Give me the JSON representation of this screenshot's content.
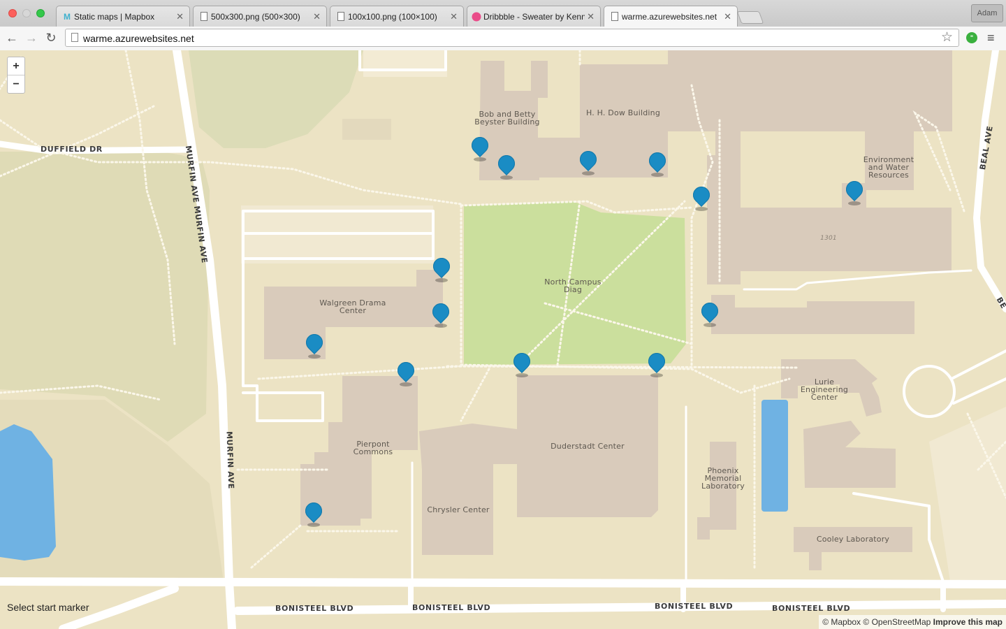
{
  "tabs": [
    {
      "title": "Static maps | Mapbox",
      "icon": "mapbox-icon"
    },
    {
      "title": "500x300.png (500×300)",
      "icon": "page-icon"
    },
    {
      "title": "100x100.png (100×100)",
      "icon": "page-icon"
    },
    {
      "title": "Dribbble - Sweater by Kenneth",
      "icon": "dribbble-icon"
    },
    {
      "title": "warme.azurewebsites.net",
      "icon": "page-icon"
    }
  ],
  "profile": {
    "name": "Adam"
  },
  "toolbar": {
    "url": "warme.azurewebsites.net",
    "back_icon": "back-arrow-icon",
    "forward_icon": "forward-arrow-icon",
    "reload_icon": "reload-icon"
  },
  "map": {
    "zoom_in_label": "+",
    "zoom_out_label": "−",
    "buildings": {
      "beyster": "Bob and Betty\nBeyster Building",
      "dow": "H. H. Dow Building",
      "ewre": "Environment\nand Water\nResources",
      "ewre_number": "1301",
      "diag": "North Campus\nDiag",
      "walgreen": "Walgreen Drama\nCenter",
      "lurie": "Lurie\nEngineering\nCenter",
      "pierpont": "Pierpont\nCommons",
      "duderstadt": "Duderstadt Center",
      "phoenix": "Phoenix\nMemorial\nLaboratory",
      "chrysler": "Chrysler Center",
      "cooley": "Cooley Laboratory"
    },
    "streets": {
      "duffield": "DUFFIELD DR",
      "murfin_upper": "MURFIN AVE MURFIN AVE",
      "murfin_lower": "MURFIN AVE",
      "beal": "BEAL AVE",
      "beal_edge": "BE",
      "bonisteel_1": "BONISTEEL BLVD",
      "bonisteel_2": "BONISTEEL BLVD",
      "bonisteel_3": "BONISTEEL BLVD",
      "bonisteel_4": "BONISTEEL BLVD"
    },
    "marker_color": "#1a8cc4",
    "marker_count": 15
  },
  "status_text": "Select start marker",
  "attribution": {
    "mapbox": "© Mapbox",
    "osm": "© OpenStreetMap",
    "improve": "Improve this map"
  }
}
